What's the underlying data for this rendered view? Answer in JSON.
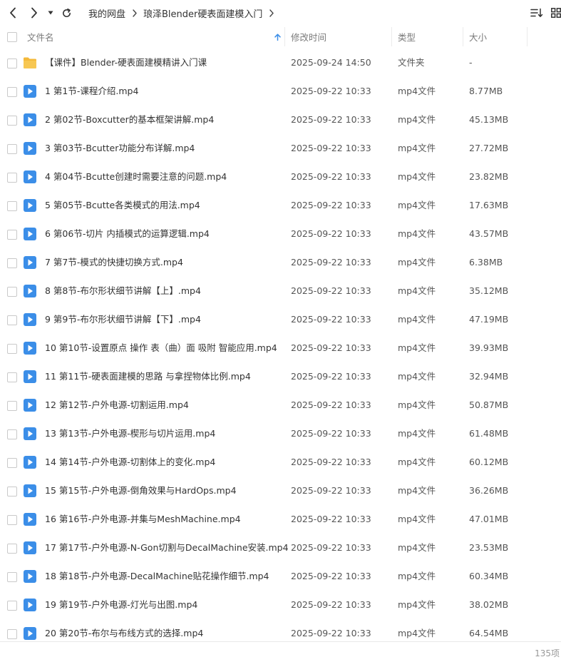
{
  "breadcrumb": {
    "items": [
      "我的网盘",
      "琅泽Blender硬表面建模入门"
    ]
  },
  "columns": {
    "name": "文件名",
    "modified": "修改时间",
    "type": "类型",
    "size": "大小"
  },
  "sort": {
    "column": "name",
    "direction": "ascending",
    "icon": "sort-up-arrow-icon"
  },
  "icons": {
    "back": "chevron-left-icon",
    "forward": "chevron-right-icon",
    "history": "caret-down-icon",
    "refresh": "refresh-icon",
    "sort_menu": "sort-lines-icon",
    "grid_view": "grid-view-icon",
    "folder": "folder-icon",
    "video": "video-file-icon"
  },
  "colors": {
    "folder": "#f4b93a",
    "video": "#3b8ee8",
    "sort_arrow": "#3b8ee8"
  },
  "files": [
    {
      "name": "【课件】Blender-硬表面建模精讲入门课",
      "modified": "2025-09-24 14:50",
      "type": "文件夹",
      "size": "-",
      "kind": "folder"
    },
    {
      "name": "1 第1节-课程介绍.mp4",
      "modified": "2025-09-22 10:33",
      "type": "mp4文件",
      "size": "8.77MB",
      "kind": "video"
    },
    {
      "name": "2 第02节-Boxcutter的基本框架讲解.mp4",
      "modified": "2025-09-22 10:33",
      "type": "mp4文件",
      "size": "45.13MB",
      "kind": "video"
    },
    {
      "name": "3 第03节-Bcutter功能分布详解.mp4",
      "modified": "2025-09-22 10:33",
      "type": "mp4文件",
      "size": "27.72MB",
      "kind": "video"
    },
    {
      "name": "4 第04节-Bcutte创建时需要注意的问题.mp4",
      "modified": "2025-09-22 10:33",
      "type": "mp4文件",
      "size": "23.82MB",
      "kind": "video"
    },
    {
      "name": "5 第05节-Bcutte各类模式的用法.mp4",
      "modified": "2025-09-22 10:33",
      "type": "mp4文件",
      "size": "17.63MB",
      "kind": "video"
    },
    {
      "name": "6 第06节-切片 内插模式的运算逻辑.mp4",
      "modified": "2025-09-22 10:33",
      "type": "mp4文件",
      "size": "43.57MB",
      "kind": "video"
    },
    {
      "name": "7 第7节-模式的快捷切换方式.mp4",
      "modified": "2025-09-22 10:33",
      "type": "mp4文件",
      "size": "6.38MB",
      "kind": "video"
    },
    {
      "name": "8 第8节-布尔形状细节讲解【上】.mp4",
      "modified": "2025-09-22 10:33",
      "type": "mp4文件",
      "size": "35.12MB",
      "kind": "video"
    },
    {
      "name": "9 第9节-布尔形状细节讲解【下】.mp4",
      "modified": "2025-09-22 10:33",
      "type": "mp4文件",
      "size": "47.19MB",
      "kind": "video"
    },
    {
      "name": "10 第10节-设置原点 操作 表（曲）面 吸附 智能应用.mp4",
      "modified": "2025-09-22 10:33",
      "type": "mp4文件",
      "size": "39.93MB",
      "kind": "video"
    },
    {
      "name": "11 第11节-硬表面建模的思路 与拿捏物体比例.mp4",
      "modified": "2025-09-22 10:33",
      "type": "mp4文件",
      "size": "32.94MB",
      "kind": "video"
    },
    {
      "name": "12 第12节-户外电源-切割运用.mp4",
      "modified": "2025-09-22 10:33",
      "type": "mp4文件",
      "size": "50.87MB",
      "kind": "video"
    },
    {
      "name": "13 第13节-户外电源-楔形与切片运用.mp4",
      "modified": "2025-09-22 10:33",
      "type": "mp4文件",
      "size": "61.48MB",
      "kind": "video"
    },
    {
      "name": "14 第14节-户外电源-切割体上的变化.mp4",
      "modified": "2025-09-22 10:33",
      "type": "mp4文件",
      "size": "60.12MB",
      "kind": "video"
    },
    {
      "name": "15 第15节-户外电源-倒角效果与HardOps.mp4",
      "modified": "2025-09-22 10:33",
      "type": "mp4文件",
      "size": "36.26MB",
      "kind": "video"
    },
    {
      "name": "16 第16节-户外电源-并集与MeshMachine.mp4",
      "modified": "2025-09-22 10:33",
      "type": "mp4文件",
      "size": "47.01MB",
      "kind": "video"
    },
    {
      "name": "17 第17节-户外电源-N-Gon切割与DecalMachine安装.mp4",
      "modified": "2025-09-22 10:33",
      "type": "mp4文件",
      "size": "23.53MB",
      "kind": "video"
    },
    {
      "name": "18 第18节-户外电源-DecalMachine贴花操作细节.mp4",
      "modified": "2025-09-22 10:33",
      "type": "mp4文件",
      "size": "60.34MB",
      "kind": "video"
    },
    {
      "name": "19 第19节-户外电源-灯光与出图.mp4",
      "modified": "2025-09-22 10:33",
      "type": "mp4文件",
      "size": "38.02MB",
      "kind": "video"
    },
    {
      "name": "20 第20节-布尔与布线方式的选择.mp4",
      "modified": "2025-09-22 10:33",
      "type": "mp4文件",
      "size": "64.54MB",
      "kind": "video"
    }
  ],
  "footer": {
    "count": "135项"
  }
}
